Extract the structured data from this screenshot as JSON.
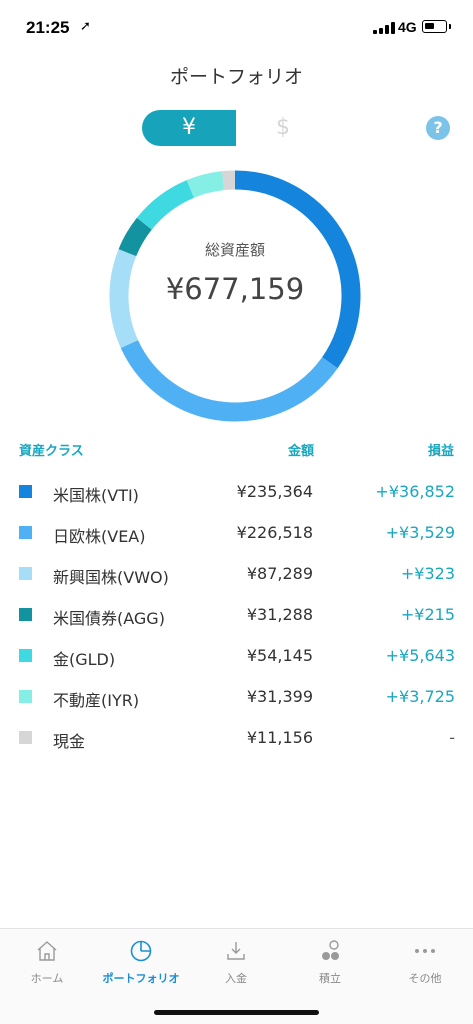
{
  "status": {
    "time": "21:25",
    "network": "4G"
  },
  "header": {
    "title": "ポートフォリオ"
  },
  "currency_toggle": {
    "yen_label": "¥",
    "usd_label": "$",
    "selected": "yen"
  },
  "help": {
    "label": "?"
  },
  "summary": {
    "label": "総資産額",
    "total": "¥677,159"
  },
  "table": {
    "headers": {
      "asset_class": "資産クラス",
      "amount": "金額",
      "gain": "損益"
    },
    "rows": [
      {
        "name": "米国株(VTI)",
        "amount": "¥235,364",
        "gain": "+¥36,852",
        "color": "#1584dc",
        "value": 235364
      },
      {
        "name": "日欧株(VEA)",
        "amount": "¥226,518",
        "gain": "+¥3,529",
        "color": "#4fb0f4",
        "value": 226518
      },
      {
        "name": "新興国株(VWO)",
        "amount": "¥87,289",
        "gain": "+¥323",
        "color": "#a6ddf7",
        "value": 87289
      },
      {
        "name": "米国債券(AGG)",
        "amount": "¥31,288",
        "gain": "+¥215",
        "color": "#13939f",
        "value": 31288
      },
      {
        "name": "金(GLD)",
        "amount": "¥54,145",
        "gain": "+¥5,643",
        "color": "#3fd9e2",
        "value": 54145
      },
      {
        "name": "不動産(IYR)",
        "amount": "¥31,399",
        "gain": "+¥3,725",
        "color": "#86efe5",
        "value": 31399
      },
      {
        "name": "現金",
        "amount": "¥11,156",
        "gain": "-",
        "color": "#d6d6d6",
        "value": 11156
      }
    ]
  },
  "tabs": [
    {
      "id": "home",
      "label": "ホーム",
      "icon": "home-icon",
      "active": false
    },
    {
      "id": "portfolio",
      "label": "ポートフォリオ",
      "icon": "pie-chart-icon",
      "active": true
    },
    {
      "id": "deposit",
      "label": "入金",
      "icon": "deposit-icon",
      "active": false
    },
    {
      "id": "accumulate",
      "label": "積立",
      "icon": "accumulate-icon",
      "active": false
    },
    {
      "id": "other",
      "label": "その他",
      "icon": "more-icon",
      "active": false
    }
  ],
  "colors": {
    "accent": "#17a3b9",
    "tab_active": "#1b8fd6",
    "help": "#7cc3ea"
  }
}
